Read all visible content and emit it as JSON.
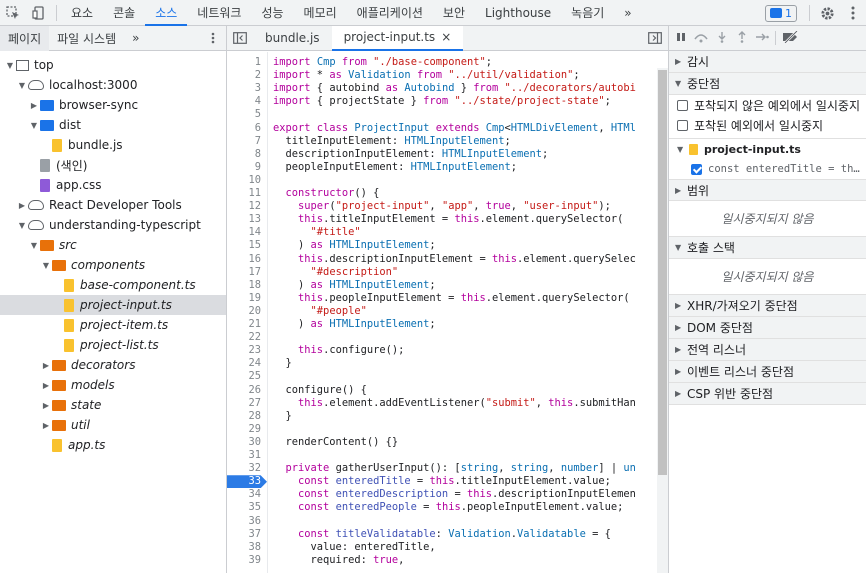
{
  "topbar": {
    "tabs": [
      {
        "label": "요소",
        "active": false
      },
      {
        "label": "콘솔",
        "active": false
      },
      {
        "label": "소스",
        "active": true
      },
      {
        "label": "네트워크",
        "active": false
      },
      {
        "label": "성능",
        "active": false
      },
      {
        "label": "메모리",
        "active": false
      },
      {
        "label": "애플리케이션",
        "active": false
      },
      {
        "label": "보안",
        "active": false
      },
      {
        "label": "Lighthouse",
        "active": false
      },
      {
        "label": "녹음기",
        "active": false
      }
    ],
    "more": "»",
    "badge_count": "1"
  },
  "navigator": {
    "tabs": [
      "페이지",
      "파일 시스템"
    ],
    "more": "»",
    "tree": [
      {
        "label": "top",
        "indent": 0,
        "arrow": "▼",
        "icon": "frame"
      },
      {
        "label": "localhost:3000",
        "indent": 1,
        "arrow": "▼",
        "icon": "cloud"
      },
      {
        "label": "browser-sync",
        "indent": 2,
        "arrow": "▶",
        "icon": "folder-blue"
      },
      {
        "label": "dist",
        "indent": 2,
        "arrow": "▼",
        "icon": "folder-blue"
      },
      {
        "label": "bundle.js",
        "indent": 3,
        "arrow": "",
        "icon": "file"
      },
      {
        "label": "(색인)",
        "indent": 2,
        "arrow": "",
        "icon": "file-gray"
      },
      {
        "label": "app.css",
        "indent": 2,
        "arrow": "",
        "icon": "file-purple"
      },
      {
        "label": "React Developer Tools",
        "indent": 1,
        "arrow": "▶",
        "icon": "cloud"
      },
      {
        "label": "understanding-typescript",
        "indent": 1,
        "arrow": "▼",
        "icon": "cloud"
      },
      {
        "label": "src",
        "indent": 2,
        "arrow": "▼",
        "icon": "folder-orange",
        "italic": true
      },
      {
        "label": "components",
        "indent": 3,
        "arrow": "▼",
        "icon": "folder-orange",
        "italic": true
      },
      {
        "label": "base-component.ts",
        "indent": 4,
        "arrow": "",
        "icon": "file",
        "italic": true
      },
      {
        "label": "project-input.ts",
        "indent": 4,
        "arrow": "",
        "icon": "file",
        "italic": true,
        "selected": true
      },
      {
        "label": "project-item.ts",
        "indent": 4,
        "arrow": "",
        "icon": "file",
        "italic": true
      },
      {
        "label": "project-list.ts",
        "indent": 4,
        "arrow": "",
        "icon": "file",
        "italic": true
      },
      {
        "label": "decorators",
        "indent": 3,
        "arrow": "▶",
        "icon": "folder-orange",
        "italic": true
      },
      {
        "label": "models",
        "indent": 3,
        "arrow": "▶",
        "icon": "folder-orange",
        "italic": true
      },
      {
        "label": "state",
        "indent": 3,
        "arrow": "▶",
        "icon": "folder-orange",
        "italic": true
      },
      {
        "label": "util",
        "indent": 3,
        "arrow": "▶",
        "icon": "folder-orange",
        "italic": true
      },
      {
        "label": "app.ts",
        "indent": 3,
        "arrow": "",
        "icon": "file",
        "italic": true
      }
    ]
  },
  "editor": {
    "tabs": [
      {
        "label": "bundle.js",
        "active": false
      },
      {
        "label": "project-input.ts",
        "active": true,
        "close": "×"
      }
    ],
    "breakpoint_line": "33",
    "lines": [
      {
        "n": "1",
        "html": "<span class=\"k\">import</span> <span class=\"t\">Cmp</span> <span class=\"k\">from</span> <span class=\"s\">\"./base-component\"</span>;"
      },
      {
        "n": "2",
        "html": "<span class=\"k\">import</span> * <span class=\"k\">as</span> <span class=\"t\">Validation</span> <span class=\"k\">from</span> <span class=\"s\">\"../util/validation\"</span>;"
      },
      {
        "n": "3",
        "html": "<span class=\"k\">import</span> { autobind <span class=\"k\">as</span> <span class=\"t\">Autobind</span> } <span class=\"k\">from</span> <span class=\"s\">\"../decorators/autobi</span>"
      },
      {
        "n": "4",
        "html": "<span class=\"k\">import</span> { projectState } <span class=\"k\">from</span> <span class=\"s\">\"../state/project-state\"</span>;"
      },
      {
        "n": "5",
        "html": ""
      },
      {
        "n": "6",
        "html": "<span class=\"k\">export class</span> <span class=\"t\">ProjectInput</span> <span class=\"k\">extends</span> <span class=\"t\">Cmp</span>&lt;<span class=\"t\">HTMLDivElement</span>, <span class=\"t\">HTMl</span>"
      },
      {
        "n": "7",
        "html": "  titleInputElement: <span class=\"t\">HTMLInputElement</span>;"
      },
      {
        "n": "8",
        "html": "  descriptionInputElement: <span class=\"t\">HTMLInputElement</span>;"
      },
      {
        "n": "9",
        "html": "  peopleInputElement: <span class=\"t\">HTMLInputElement</span>;"
      },
      {
        "n": "10",
        "html": ""
      },
      {
        "n": "11",
        "html": "  <span class=\"k\">constructor</span>() {"
      },
      {
        "n": "12",
        "html": "    <span class=\"k\">super</span>(<span class=\"s\">\"project-input\"</span>, <span class=\"s\">\"app\"</span>, <span class=\"k\">true</span>, <span class=\"s\">\"user-input\"</span>);"
      },
      {
        "n": "13",
        "html": "    <span class=\"k\">this</span>.titleInputElement = <span class=\"k\">this</span>.element.querySelector("
      },
      {
        "n": "14",
        "html": "      <span class=\"s\">\"#title\"</span>"
      },
      {
        "n": "15",
        "html": "    ) <span class=\"k\">as</span> <span class=\"t\">HTMLInputElement</span>;"
      },
      {
        "n": "16",
        "html": "    <span class=\"k\">this</span>.descriptionInputElement = <span class=\"k\">this</span>.element.querySelec"
      },
      {
        "n": "17",
        "html": "      <span class=\"s\">\"#description\"</span>"
      },
      {
        "n": "18",
        "html": "    ) <span class=\"k\">as</span> <span class=\"t\">HTMLInputElement</span>;"
      },
      {
        "n": "19",
        "html": "    <span class=\"k\">this</span>.peopleInputElement = <span class=\"k\">this</span>.element.querySelector("
      },
      {
        "n": "20",
        "html": "      <span class=\"s\">\"#people\"</span>"
      },
      {
        "n": "21",
        "html": "    ) <span class=\"k\">as</span> <span class=\"t\">HTMLInputElement</span>;"
      },
      {
        "n": "22",
        "html": ""
      },
      {
        "n": "23",
        "html": "    <span class=\"k\">this</span>.configure();"
      },
      {
        "n": "24",
        "html": "  }"
      },
      {
        "n": "25",
        "html": ""
      },
      {
        "n": "26",
        "html": "  configure() {"
      },
      {
        "n": "27",
        "html": "    <span class=\"k\">this</span>.element.addEventListener(<span class=\"s\">\"submit\"</span>, <span class=\"k\">this</span>.submitHan"
      },
      {
        "n": "28",
        "html": "  }"
      },
      {
        "n": "29",
        "html": ""
      },
      {
        "n": "30",
        "html": "  renderContent() {}"
      },
      {
        "n": "31",
        "html": ""
      },
      {
        "n": "32",
        "html": "  <span class=\"k\">private</span> gatherUserInput(): [<span class=\"t\">string</span>, <span class=\"t\">string</span>, <span class=\"t\">number</span>] | <span class=\"t\">un</span>"
      },
      {
        "n": "33",
        "html": "    <span class=\"k\">const</span> <span class=\"v\">enteredTitle</span> = <span class=\"k\">this</span>.titleInputElement.value;"
      },
      {
        "n": "34",
        "html": "    <span class=\"k\">const</span> <span class=\"v\">enteredDescription</span> = <span class=\"k\">this</span>.descriptionInputElemen"
      },
      {
        "n": "35",
        "html": "    <span class=\"k\">const</span> <span class=\"v\">enteredPeople</span> = <span class=\"k\">this</span>.peopleInputElement.value;"
      },
      {
        "n": "36",
        "html": ""
      },
      {
        "n": "37",
        "html": "    <span class=\"k\">const</span> <span class=\"v\">titleValidatable</span>: <span class=\"t\">Validation</span>.<span class=\"t\">Validatable</span> = {"
      },
      {
        "n": "38",
        "html": "      value: enteredTitle,"
      },
      {
        "n": "39",
        "html": "      required: <span class=\"k\">true</span>,"
      }
    ]
  },
  "debugger": {
    "sections": {
      "watch": "감시",
      "breakpoints": "중단점",
      "pause_uncaught": "포착되지 않은 예외에서 일시중지",
      "pause_caught": "포착된 예외에서 일시중지",
      "bp_file": "project-input.ts",
      "bp_code": "const enteredTitle = th…",
      "scope": "범위",
      "scope_paused": "일시중지되지 않음",
      "callstack": "호출 스택",
      "callstack_paused": "일시중지되지 않음",
      "xhr": "XHR/가져오기 중단점",
      "dom": "DOM 중단점",
      "global": "전역 리스너",
      "event": "이벤트 리스너 중단점",
      "csp": "CSP 위반 중단점"
    }
  }
}
